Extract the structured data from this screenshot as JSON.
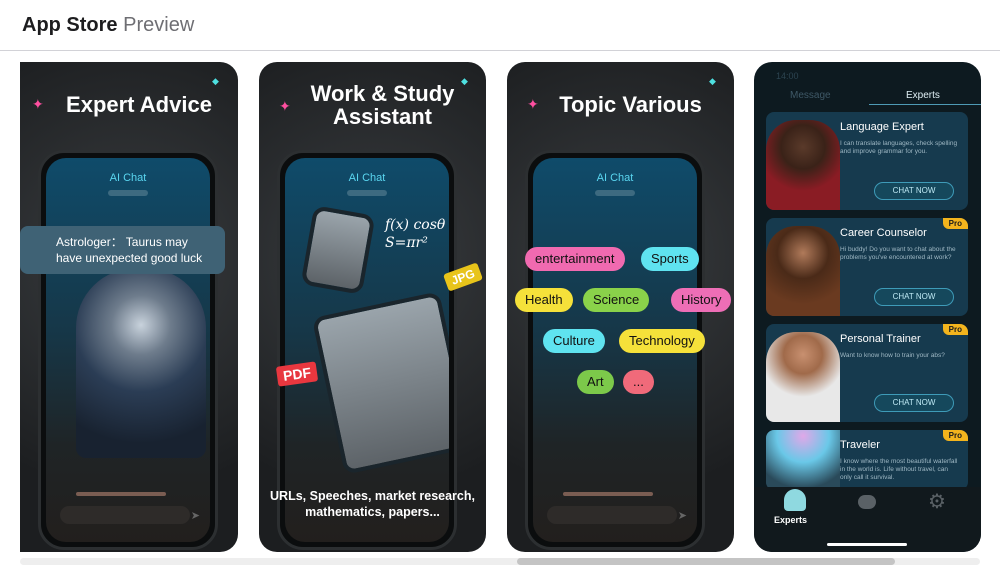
{
  "header": {
    "brand": "App Store",
    "section": "Preview"
  },
  "screenshots": [
    {
      "title": "Expert Advice",
      "screen_title": "AI Chat",
      "bubble": "Astrologer： Taurus may have unexpected good luck"
    },
    {
      "title_line1": "Work & Study",
      "title_line2": "Assistant",
      "screen_title": "AI Chat",
      "formula1": "f(x) cosθ",
      "formula2": "S=πr²",
      "pdf_label": "PDF",
      "jpg_label": "JPG",
      "caption": "URLs, Speeches, market research, mathematics, papers..."
    },
    {
      "title": "Topic Various",
      "screen_title": "AI Chat",
      "chips": [
        {
          "label": "entertainment",
          "color": "#f06ab0"
        },
        {
          "label": "Sports",
          "color": "#5fe3f0"
        },
        {
          "label": "Health",
          "color": "#f5e13a"
        },
        {
          "label": "Science",
          "color": "#8ad24a"
        },
        {
          "label": "History",
          "color": "#ee6eb6"
        },
        {
          "label": "Culture",
          "color": "#5fe3f0"
        },
        {
          "label": "Technology",
          "color": "#f5e13a"
        },
        {
          "label": "Art",
          "color": "#7cc94a"
        },
        {
          "label": "...",
          "color": "#f06a7a"
        }
      ]
    },
    {
      "time": "14:00",
      "tabs": [
        "Message",
        "Experts"
      ],
      "active_tab": "Experts",
      "experts": [
        {
          "name": "Language Expert",
          "desc": "I can translate languages, check spelling and improve grammar for you.",
          "action": "CHAT NOW",
          "pro": ""
        },
        {
          "name": "Career Counselor",
          "desc": "Hi buddy! Do you want to chat about the problems you've encountered at work?",
          "action": "CHAT NOW",
          "pro": "Pro"
        },
        {
          "name": "Personal Trainer",
          "desc": "Want to know how to train your abs?",
          "action": "CHAT NOW",
          "pro": "Pro"
        },
        {
          "name": "Traveler",
          "desc": "I know where the most beautiful waterfall in the world is. Life without travel, can only call it survival.",
          "action": "",
          "pro": "Pro"
        }
      ],
      "nav": {
        "experts_label": "Experts"
      }
    }
  ],
  "colors": {
    "accent": "#4ee0e0",
    "pro_badge": "#f3b41d"
  }
}
